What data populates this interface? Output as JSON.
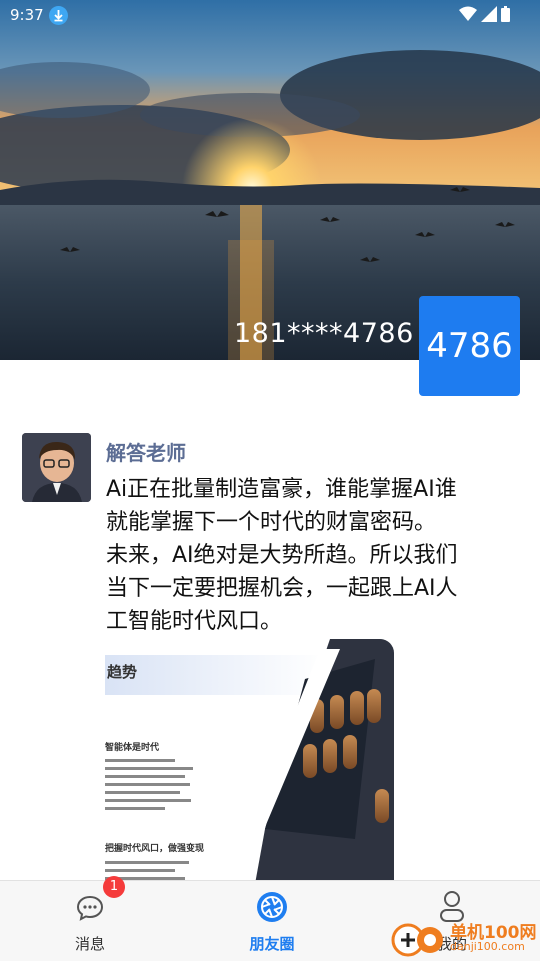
{
  "status_bar": {
    "time": "9:37"
  },
  "cover": {
    "phone": "181****4786",
    "avatar_text": "4786"
  },
  "post": {
    "author": "解答老师",
    "lines": [
      "Ai正在批量制造富豪，谁能掌握AI谁",
      "就能掌握下一个时代的财富密码。",
      "未来，AI绝对是大势所趋。所以我们",
      "当下一定要把握机会，一起跟上AI人",
      "工智能时代风口。"
    ],
    "image_heading": "趋势",
    "image_sub1": "智能体是时代",
    "image_sub2": "把握时代风口，做强变现"
  },
  "nav": {
    "items": [
      {
        "label": "消息",
        "icon": "chat-icon"
      },
      {
        "label": "朋友圈",
        "icon": "moments-icon"
      },
      {
        "label": "我的",
        "icon": "profile-icon"
      }
    ],
    "badge": "1",
    "active_color": "#1f7ef0"
  },
  "watermark": {
    "brand": "单机100网",
    "url": "danji100.com"
  }
}
